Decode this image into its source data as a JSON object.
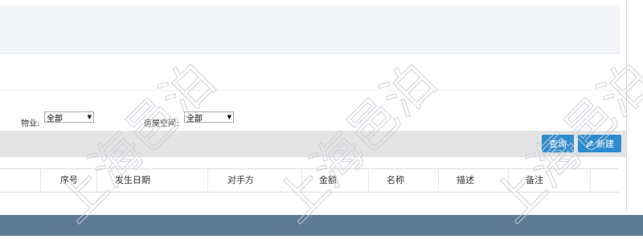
{
  "filters": {
    "property_label": "物业:",
    "property_value": "全部",
    "room_space_label": "房屋空间:",
    "room_space_value": "全部"
  },
  "toolbar": {
    "query_label": "查询",
    "new_label": "新建"
  },
  "table": {
    "columns": [
      "序号",
      "发生日期",
      "对手方",
      "金额",
      "名称",
      "描述",
      "备注"
    ]
  },
  "watermark": {
    "text": "上海邑泊"
  },
  "colors": {
    "primary_button": "#2d8ccf",
    "footer_bar": "#5e7b96",
    "toolbar_bg": "#e4e4e4"
  }
}
